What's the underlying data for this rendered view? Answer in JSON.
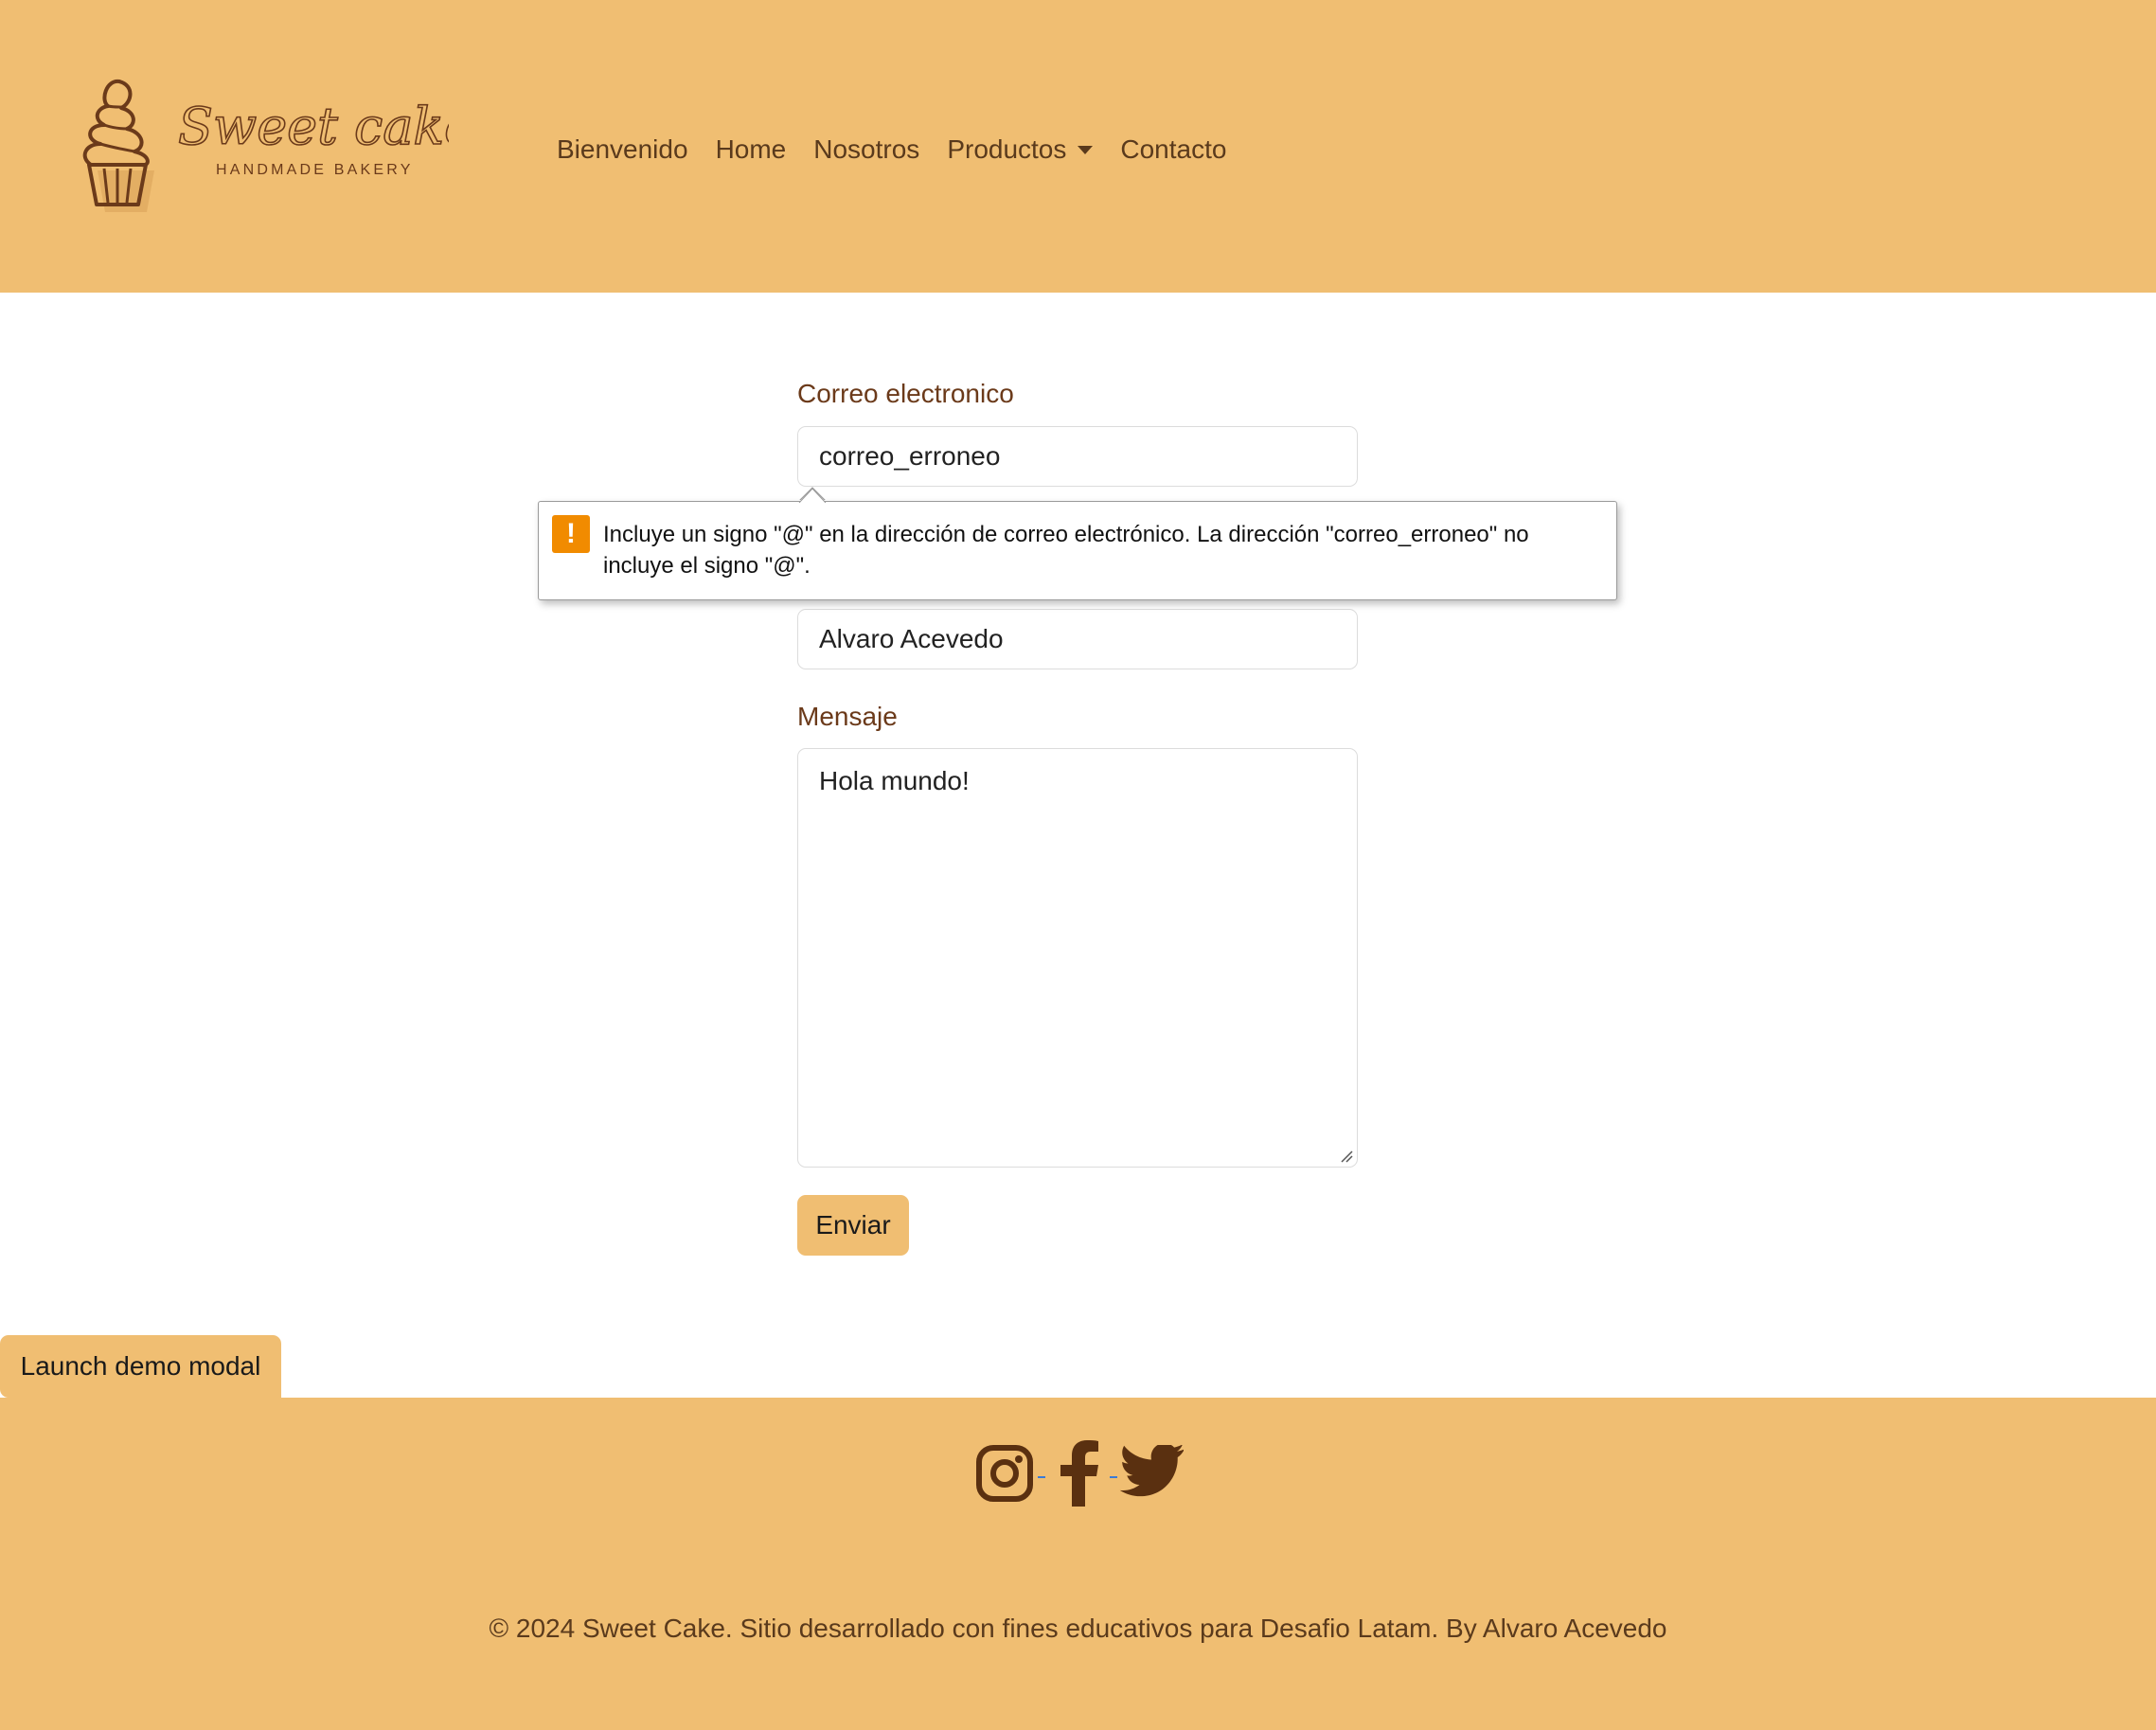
{
  "colors": {
    "brand": "#f0be72",
    "text_brown": "#6b3a1a",
    "warning": "#f18b00"
  },
  "brand": {
    "name": "Sweet cake",
    "tagline": "HANDMADE BAKERY"
  },
  "nav": {
    "items": [
      {
        "label": "Bienvenido"
      },
      {
        "label": "Home"
      },
      {
        "label": "Nosotros"
      },
      {
        "label": "Productos",
        "dropdown": true
      },
      {
        "label": "Contacto"
      }
    ]
  },
  "form": {
    "email": {
      "label": "Correo electronico",
      "value": "correo_erroneo"
    },
    "name": {
      "value": "Alvaro Acevedo"
    },
    "message": {
      "label": "Mensaje",
      "value": "Hola mundo!"
    },
    "submit_label": "Enviar"
  },
  "validation": {
    "icon": "warning-icon",
    "message": "Incluye un signo \"@\" en la dirección de correo electrónico. La dirección \"correo_erroneo\" no incluye el signo \"@\"."
  },
  "modal_button": {
    "label": "Launch demo modal"
  },
  "footer": {
    "social_icons": [
      "instagram-icon",
      "facebook-icon",
      "twitter-icon"
    ],
    "copyright": "© 2024 Sweet Cake. Sitio desarrollado con fines educativos para Desafio Latam. By Alvaro Acevedo"
  }
}
